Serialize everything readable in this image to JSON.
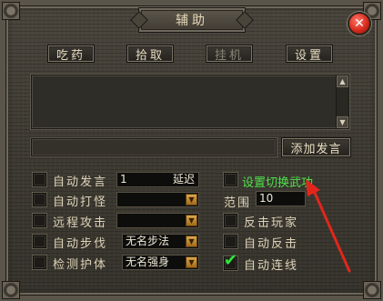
{
  "window": {
    "title": "辅助"
  },
  "tabs": [
    {
      "label": "吃药"
    },
    {
      "label": "拾取"
    },
    {
      "label": "挂机"
    },
    {
      "label": "设置"
    }
  ],
  "message": {
    "add_label": "添加发言"
  },
  "options": {
    "auto_speak": {
      "label": "自动发言",
      "value": "1",
      "delay_label": "延迟"
    },
    "auto_hit": {
      "label": "自动打怪",
      "value": ""
    },
    "remote_attack": {
      "label": "远程攻击",
      "value": ""
    },
    "auto_step": {
      "label": "自动步伐",
      "value": "无名步法"
    },
    "detect_guard": {
      "label": "检测护体",
      "value": "无名强身"
    },
    "switch_weapon": {
      "label": "设置切换武功",
      "checked": false
    },
    "range": {
      "label": "范围",
      "value": "10"
    },
    "counter_player": {
      "label": "反击玩家",
      "checked": false
    },
    "auto_counter": {
      "label": "自动反击",
      "checked": false
    },
    "auto_combo": {
      "label": "自动连线",
      "checked": true
    }
  },
  "colors": {
    "accent_green": "#4fe04a",
    "close_red": "#d82a1d",
    "annotation_red": "#e2261c"
  }
}
